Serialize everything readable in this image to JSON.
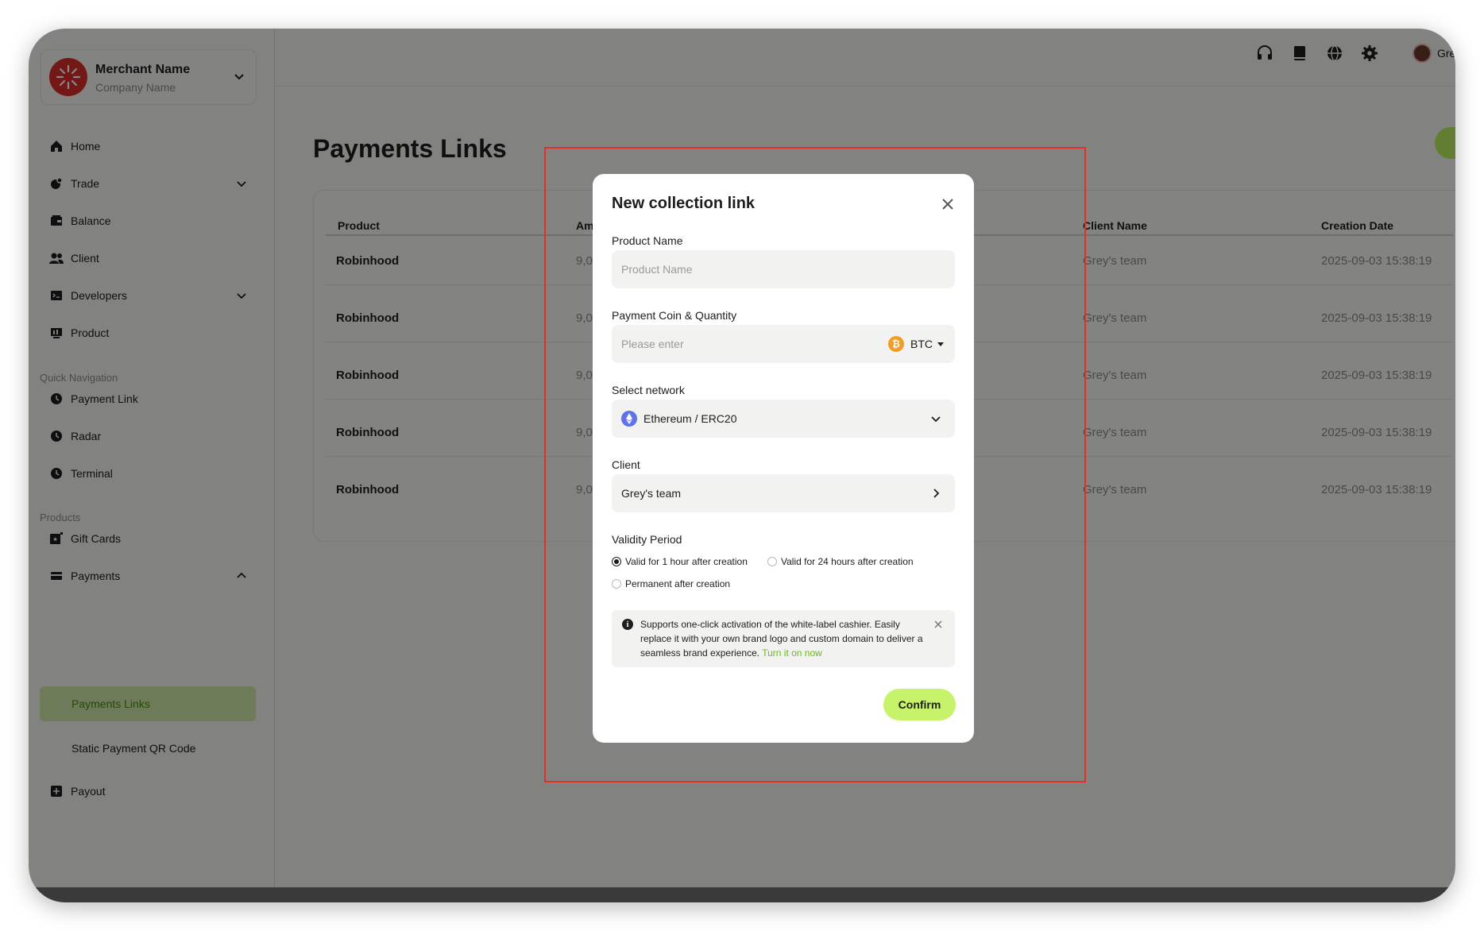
{
  "merchant": {
    "name": "Merchant Name",
    "company": "Company Name"
  },
  "sidebar": {
    "items": [
      {
        "label": "Home",
        "icon": "home-icon"
      },
      {
        "label": "Trade",
        "icon": "trade-icon"
      },
      {
        "label": "Balance",
        "icon": "balance-icon"
      },
      {
        "label": "Client",
        "icon": "client-icon"
      },
      {
        "label": "Developers",
        "icon": "developers-icon"
      },
      {
        "label": "Product",
        "icon": "product-icon"
      }
    ],
    "quick_nav_label": "Quick Navigation",
    "quick_nav": [
      {
        "label": "Payment Link",
        "icon": "clock-icon"
      },
      {
        "label": "Radar",
        "icon": "clock-icon"
      },
      {
        "label": "Terminal",
        "icon": "clock-icon"
      }
    ],
    "products_label": "Products",
    "products": [
      {
        "label": "Gift Cards",
        "icon": "gift-card-icon"
      },
      {
        "label": "Payments",
        "icon": "payments-icon"
      }
    ],
    "payments_sub": [
      "Payments Links",
      "Static Payment QR Code"
    ],
    "payout": {
      "label": "Payout",
      "icon": "payout-icon"
    }
  },
  "topbar": {
    "icons": [
      "headset-icon",
      "book-icon",
      "globe-icon",
      "gear-icon"
    ],
    "user": "Gre"
  },
  "page": {
    "title": "Payments Links"
  },
  "table": {
    "headers": [
      "Product",
      "Am",
      "Client Name",
      "Creation Date"
    ],
    "rows": [
      {
        "product": "Robinhood",
        "amount": "9,0",
        "client": "Grey's team",
        "date": "2025-09-03 15:38:19"
      },
      {
        "product": "Robinhood",
        "amount": "9,0",
        "client": "Grey's team",
        "date": "2025-09-03 15:38:19"
      },
      {
        "product": "Robinhood",
        "amount": "9,0",
        "client": "Grey's team",
        "date": "2025-09-03 15:38:19"
      },
      {
        "product": "Robinhood",
        "amount": "9,0",
        "client": "Grey's team",
        "date": "2025-09-03 15:38:19"
      },
      {
        "product": "Robinhood",
        "amount": "9,0",
        "client": "Grey's team",
        "date": "2025-09-03 15:38:19"
      }
    ]
  },
  "modal": {
    "title": "New collection link",
    "product_label": "Product Name",
    "product_placeholder": "Product Name",
    "coin_label": "Payment Coin & Quantity",
    "coin_placeholder": "Please enter",
    "coin": "BTC",
    "coin_symbol": "₿",
    "network_label": "Select network",
    "network": "Ethereum / ERC20",
    "client_label": "Client",
    "client": "Grey's team",
    "validity_label": "Validity Period",
    "validity_options": [
      "Valid for 1 hour after creation",
      "Valid for 24 hours after creation",
      "Permanent after creation"
    ],
    "validity_selected": "Valid for 1 hour after creation",
    "notice_icon": "i",
    "notice": "Supports one-click activation of the white-label cashier. Easily replace it with your own brand logo and custom domain to deliver a seamless brand experience.",
    "notice_link": "Turn it on now",
    "confirm": "Confirm"
  },
  "colors": {
    "accent": "#c7f36a",
    "brand_red": "#d92d2d",
    "highlight": "#e0302a",
    "link": "#6cb81d"
  }
}
